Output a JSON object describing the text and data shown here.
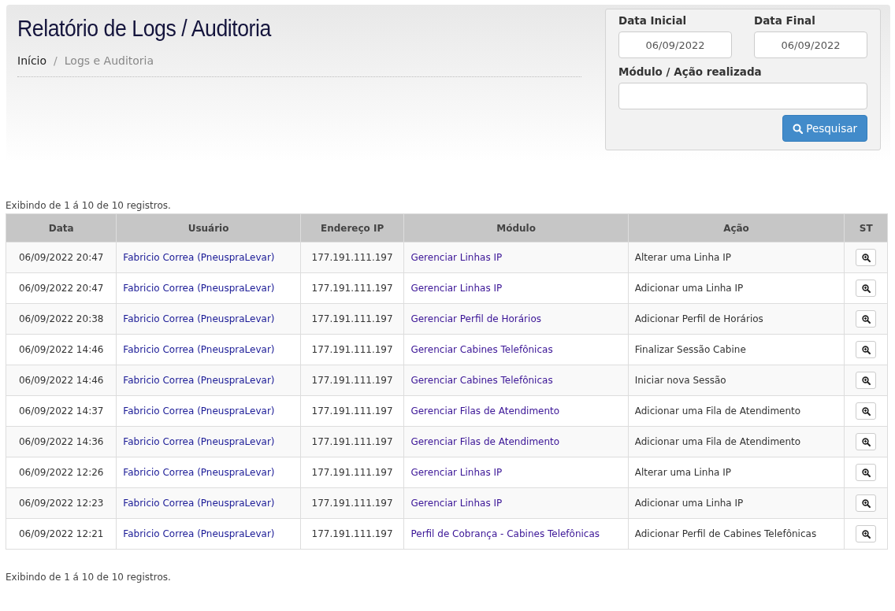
{
  "page": {
    "title": "Relatório de Logs / Auditoria"
  },
  "breadcrumb": [
    {
      "label": "Início"
    },
    {
      "label": "Logs e Auditoria"
    }
  ],
  "breadcrumb_separator": "/",
  "filters": {
    "start_date": {
      "label": "Data Inicial",
      "value": "06/09/2022"
    },
    "end_date": {
      "label": "Data Final",
      "value": "06/09/2022"
    },
    "module_action": {
      "label": "Módulo / Ação realizada"
    },
    "search_button": "Pesquisar"
  },
  "summary_top": "Exibindo de 1 á 10 de 10 registros.",
  "table": {
    "columns": [
      "Data",
      "Usuário",
      "Endereço IP",
      "Módulo",
      "Ação",
      "ST"
    ],
    "rows": [
      {
        "date": "06/09/2022 20:47",
        "user": "Fabricio Correa (PneuspraLevar)",
        "ip": "177.191.111.197",
        "module": "Gerenciar Linhas IP",
        "action": "Alterar uma Linha IP"
      },
      {
        "date": "06/09/2022 20:47",
        "user": "Fabricio Correa (PneuspraLevar)",
        "ip": "177.191.111.197",
        "module": "Gerenciar Linhas IP",
        "action": "Adicionar uma Linha IP"
      },
      {
        "date": "06/09/2022 20:38",
        "user": "Fabricio Correa (PneuspraLevar)",
        "ip": "177.191.111.197",
        "module": "Gerenciar Perfil de Horários",
        "action": "Adicionar Perfil de Horários"
      },
      {
        "date": "06/09/2022 14:46",
        "user": "Fabricio Correa (PneuspraLevar)",
        "ip": "177.191.111.197",
        "module": "Gerenciar Cabines Telefônicas",
        "action": "Finalizar Sessão Cabine"
      },
      {
        "date": "06/09/2022 14:46",
        "user": "Fabricio Correa (PneuspraLevar)",
        "ip": "177.191.111.197",
        "module": "Gerenciar Cabines Telefônicas",
        "action": "Iniciar nova Sessão"
      },
      {
        "date": "06/09/2022 14:37",
        "user": "Fabricio Correa (PneuspraLevar)",
        "ip": "177.191.111.197",
        "module": "Gerenciar Filas de Atendimento",
        "action": "Adicionar uma Fila de Atendimento"
      },
      {
        "date": "06/09/2022 14:36",
        "user": "Fabricio Correa (PneuspraLevar)",
        "ip": "177.191.111.197",
        "module": "Gerenciar Filas de Atendimento",
        "action": "Adicionar uma Fila de Atendimento"
      },
      {
        "date": "06/09/2022 12:26",
        "user": "Fabricio Correa (PneuspraLevar)",
        "ip": "177.191.111.197",
        "module": "Gerenciar Linhas IP",
        "action": "Alterar uma Linha IP"
      },
      {
        "date": "06/09/2022 12:23",
        "user": "Fabricio Correa (PneuspraLevar)",
        "ip": "177.191.111.197",
        "module": "Gerenciar Linhas IP",
        "action": "Adicionar uma Linha IP"
      },
      {
        "date": "06/09/2022 12:21",
        "user": "Fabricio Correa (PneuspraLevar)",
        "ip": "177.191.111.197",
        "module": "Perfil de Cobrança - Cabines Telefônicas",
        "action": "Adicionar Perfil de Cabines Telefônicas"
      }
    ]
  },
  "summary_bottom": "Exibindo de 1 á 10 de 10 registros."
}
